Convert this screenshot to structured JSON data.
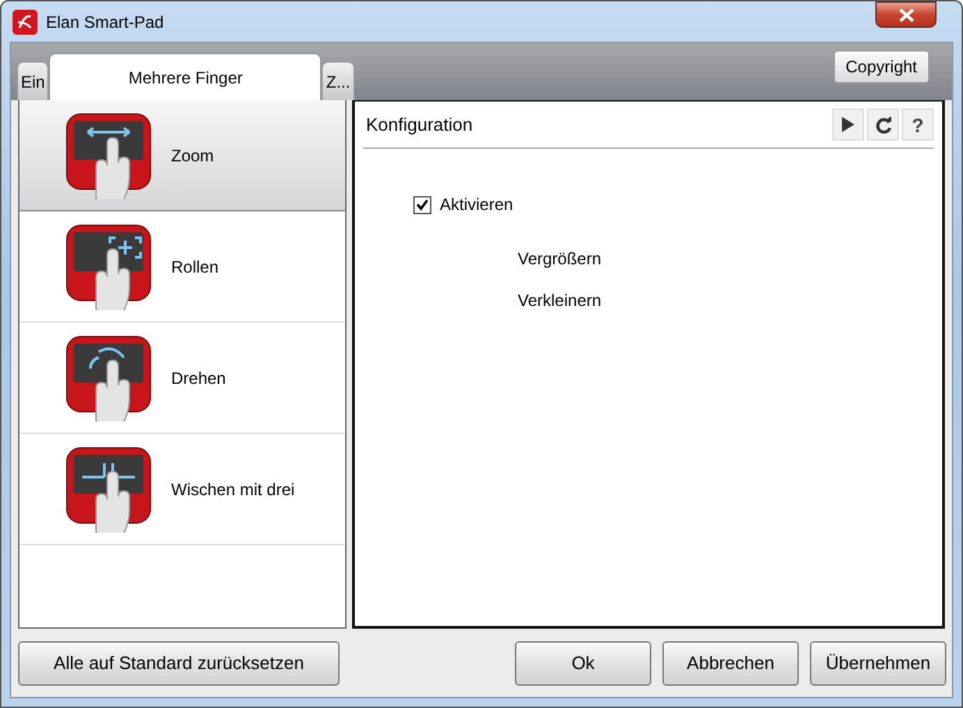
{
  "window": {
    "title": "Elan Smart-Pad"
  },
  "tabs": [
    {
      "label": "Ein",
      "selected": false
    },
    {
      "label": "Mehrere Finger",
      "selected": true
    },
    {
      "label": "Z...",
      "selected": false
    }
  ],
  "copyright_button": "Copyright",
  "gestures": [
    {
      "label": "Zoom",
      "selected": true,
      "kind": "zoom"
    },
    {
      "label": "Rollen",
      "selected": false,
      "kind": "scroll"
    },
    {
      "label": "Drehen",
      "selected": false,
      "kind": "rotate"
    },
    {
      "label": "Wischen mit drei",
      "selected": false,
      "kind": "swipe"
    }
  ],
  "config": {
    "title": "Konfiguration",
    "help_button": "?",
    "enable": {
      "label": "Aktivieren",
      "checked": true
    },
    "options": [
      "Vergrößern",
      "Verkleinern"
    ]
  },
  "reset_button": "Alle auf Standard zurücksetzen",
  "buttons": [
    "Ok",
    "Abbrechen",
    "Übernehmen"
  ]
}
